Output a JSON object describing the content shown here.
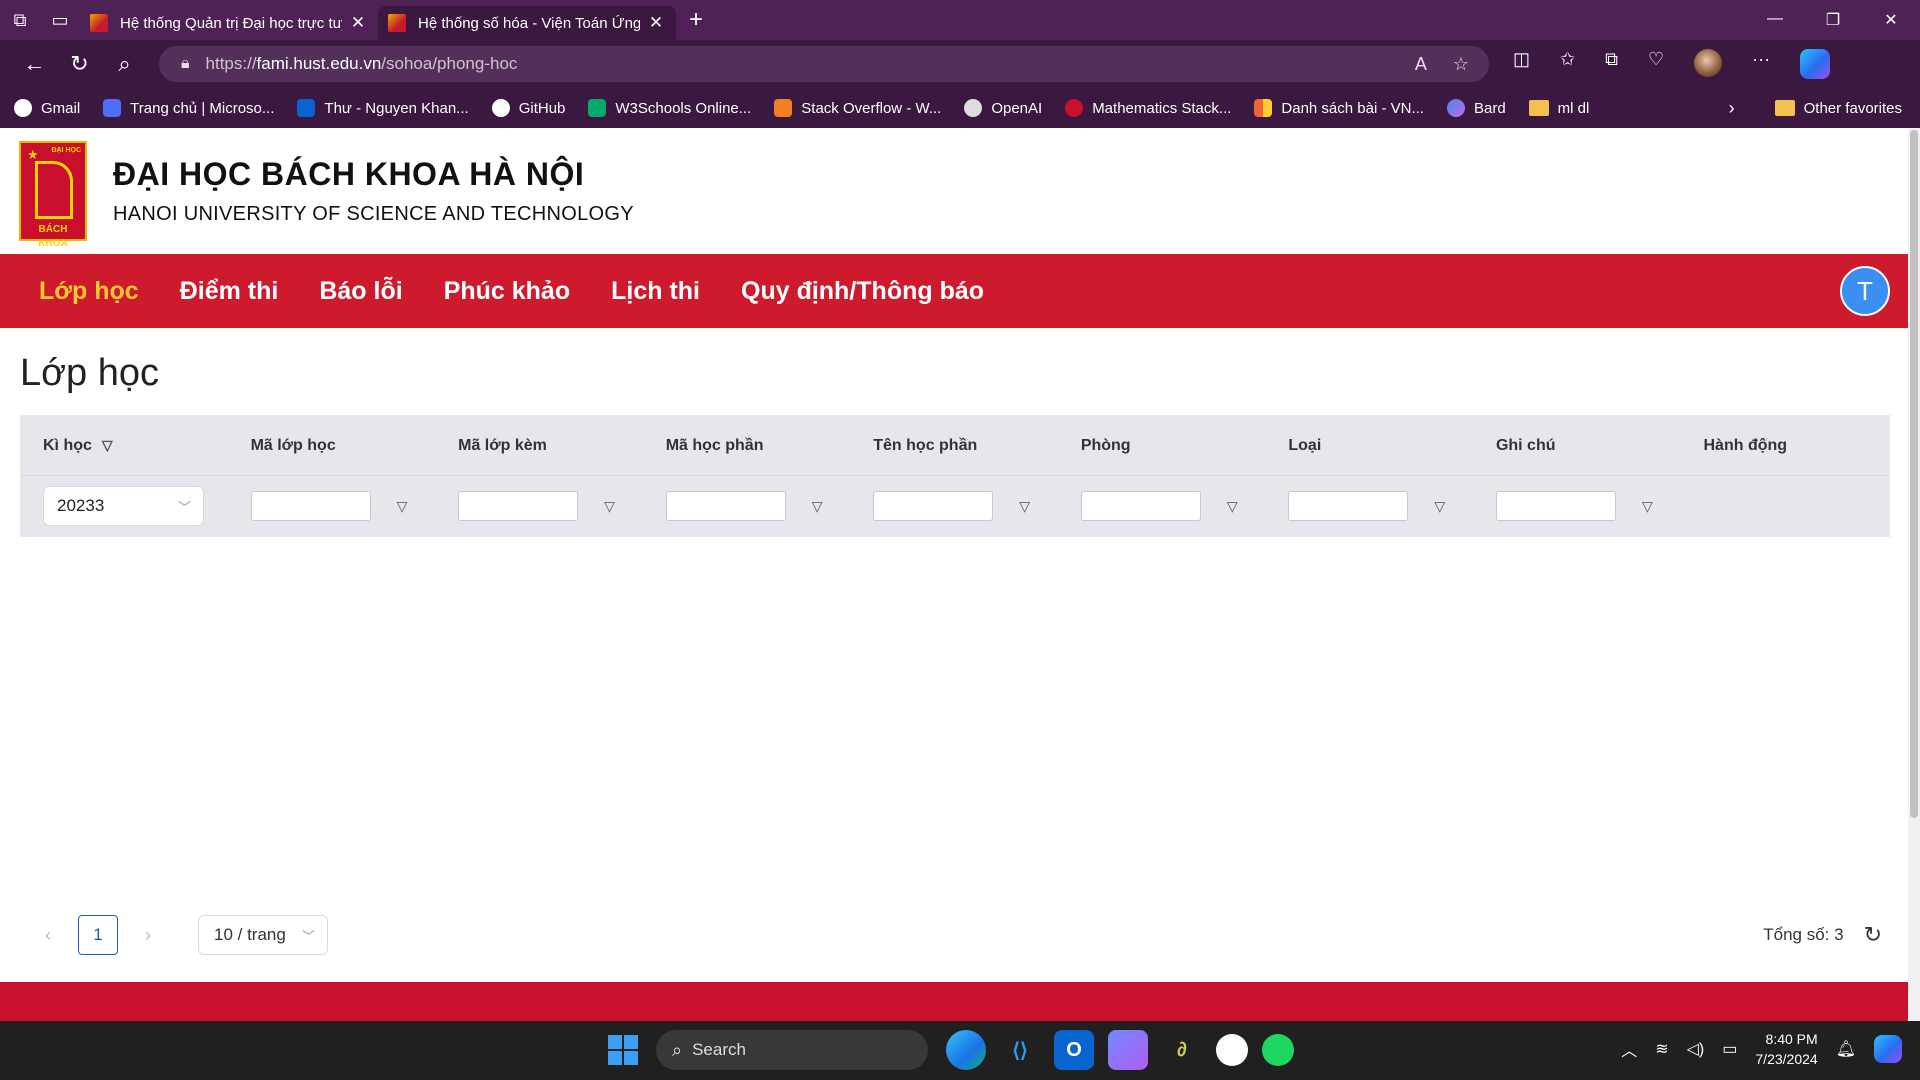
{
  "browser": {
    "tabs": [
      {
        "title": "Hệ thống Quản trị Đại học trực tuyến",
        "active": false
      },
      {
        "title": "Hệ thống số hóa - Viện Toán Ứng dụng",
        "active": true
      }
    ],
    "url_prefix": "https://",
    "url_host": "fami.hust.edu.vn",
    "url_path": "/sohoa/phong-hoc",
    "bookmarks": [
      "Gmail",
      "Trang chủ | Microso...",
      "Thư - Nguyen Khan...",
      "GitHub",
      "W3Schools Online...",
      "Stack Overflow - W...",
      "OpenAI",
      "Mathematics Stack...",
      "Danh sách bài - VN...",
      "Bard",
      "ml dl"
    ],
    "other_favorites": "Other favorites"
  },
  "site": {
    "logo_top": "ĐẠI HỌC",
    "logo_bottom": "BÁCH KHOA",
    "name_vn": "ĐẠI HỌC BÁCH KHOA HÀ NỘI",
    "name_en": "HANOI UNIVERSITY OF SCIENCE AND TECHNOLOGY",
    "nav": [
      "Lớp học",
      "Điểm thi",
      "Báo lỗi",
      "Phúc khảo",
      "Lịch thi",
      "Quy định/Thông báo"
    ],
    "active_nav": "Lớp học",
    "user_initial": "T"
  },
  "main": {
    "title": "Lớp học",
    "columns": [
      "Kì học",
      "Mã lớp học",
      "Mã lớp kèm",
      "Mã học phần",
      "Tên học phần",
      "Phòng",
      "Loại",
      "Ghi chú",
      "Hành động"
    ],
    "term_value": "20233"
  },
  "pagination": {
    "current_page": "1",
    "page_size": "10 / trang",
    "total": "Tổng số: 3"
  },
  "taskbar": {
    "search_label": "Search",
    "time": "8:40 PM",
    "date": "7/23/2024"
  },
  "colors": {
    "brand_red": "#ce1a2d",
    "active_nav": "#ffc832",
    "browser_frame": "#3a1840"
  }
}
